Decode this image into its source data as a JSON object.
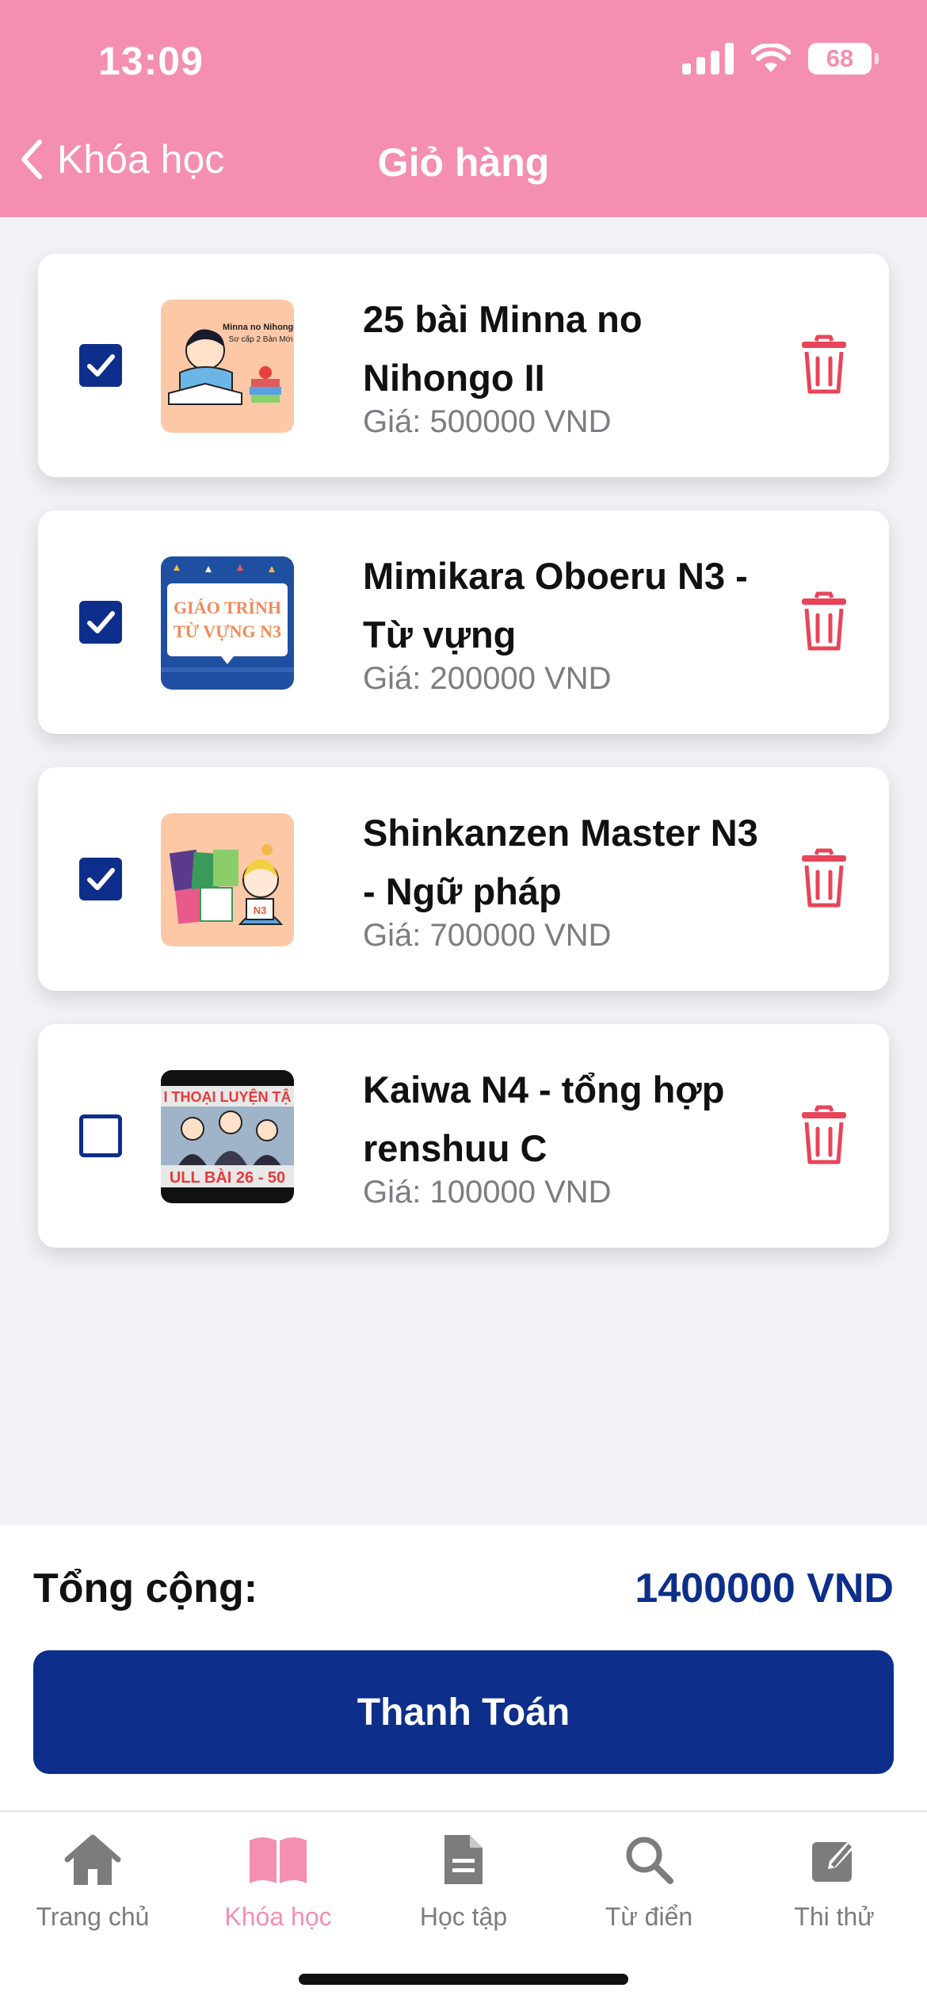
{
  "status": {
    "time": "13:09",
    "battery": "68"
  },
  "nav": {
    "back_label": "Khóa học",
    "title": "Giỏ hàng"
  },
  "cart": {
    "items": [
      {
        "title": "25 bài Minna no Nihongo II",
        "price": "Giá: 500000 VND",
        "checked": true,
        "thumb_text": [
          "Minna no Nihongo",
          "Sơ cấp 2 Bản Mới"
        ]
      },
      {
        "title": "Mimikara Oboeru N3 - Từ vựng",
        "price": "Giá: 200000 VND",
        "checked": true,
        "thumb_text": [
          "GIÁO TRÌNH",
          "TỪ VỰNG N3"
        ]
      },
      {
        "title": "Shinkanzen Master N3 - Ngữ pháp",
        "price": "Giá: 700000 VND",
        "checked": true,
        "thumb_text": [
          "N3"
        ]
      },
      {
        "title": "Kaiwa N4 - tổng hợp renshuu C",
        "price": "Giá: 100000 VND",
        "checked": false,
        "thumb_text": [
          "I THOẠI LUYỆN TẬ",
          "ULL BÀI 26 - 50"
        ]
      }
    ]
  },
  "summary": {
    "total_label": "Tổng cộng:",
    "total_value": "1400000 VND",
    "checkout_label": "Thanh Toán"
  },
  "tabs": [
    {
      "label": "Trang chủ",
      "icon": "home-icon",
      "active": false
    },
    {
      "label": "Khóa học",
      "icon": "book-icon",
      "active": true
    },
    {
      "label": "Học tập",
      "icon": "document-icon",
      "active": false
    },
    {
      "label": "Từ điển",
      "icon": "search-icon",
      "active": false
    },
    {
      "label": "Thi thử",
      "icon": "edit-icon",
      "active": false
    }
  ],
  "colors": {
    "header": "#f48fb1",
    "primary": "#0d2e8a",
    "danger": "#e8445a",
    "background": "#f2f2f7"
  }
}
